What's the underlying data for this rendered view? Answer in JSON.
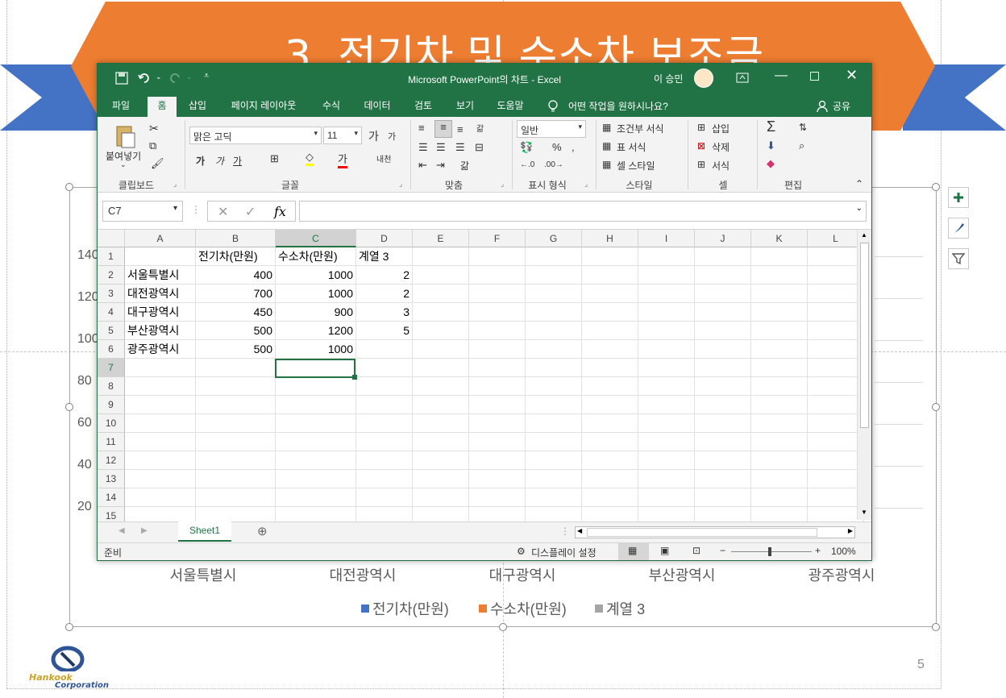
{
  "slide": {
    "title": "3. 전기차 및 수소차 보조금",
    "page_number": "5",
    "logo_text": "Hankook Corporation",
    "y_ticks": [
      "140",
      "120",
      "100",
      "80",
      "60",
      "40",
      "20"
    ],
    "categories": [
      "서울특별시",
      "대전광역시",
      "대구광역시",
      "부산광역시",
      "광주광역시"
    ],
    "legend": [
      {
        "label": "전기차(만원)",
        "color": "#4472c4"
      },
      {
        "label": "수소차(만원)",
        "color": "#ed7d31"
      },
      {
        "label": "계열 3",
        "color": "#a5a5a5"
      }
    ],
    "banner_colors": {
      "orange": "#ed7d31",
      "blue": "#4472c4"
    }
  },
  "excel": {
    "window_title": "Microsoft PowerPoint의 차트  -  Excel",
    "user": "이 승민",
    "tabs": [
      "파일",
      "홈",
      "삽입",
      "페이지 레이아웃",
      "수식",
      "데이터",
      "검토",
      "보기",
      "도움말"
    ],
    "active_tab": "홈",
    "tell_me": "어떤 작업을 원하시나요?",
    "share": "공유",
    "ribbon": {
      "paste": "붙여넣기",
      "clipboard": "클립보드",
      "font_name": "맑은 고딕",
      "font_size": "11",
      "font": "글꼴",
      "alignment": "맞춤",
      "number_format": "일반",
      "number": "표시 형식",
      "cond_format": "조건부 서식",
      "table_format": "표 서식",
      "cell_style": "셀 스타일",
      "styles": "스타일",
      "insert": "삽입",
      "delete": "삭제",
      "format": "서식",
      "cells": "셀",
      "editing": "편집"
    },
    "name_box": "C7",
    "formula": "",
    "columns": [
      "A",
      "B",
      "C",
      "D",
      "E",
      "F",
      "G",
      "H",
      "I",
      "J",
      "K",
      "L"
    ],
    "rows": [
      "1",
      "2",
      "3",
      "4",
      "5",
      "6",
      "7",
      "8",
      "9",
      "10",
      "11",
      "12",
      "13",
      "14",
      "15"
    ],
    "data": [
      [
        "",
        "전기차(만원)",
        "수소차(만원)",
        "계열 3"
      ],
      [
        "서울특별시",
        "400",
        "1000",
        "2"
      ],
      [
        "대전광역시",
        "700",
        "1000",
        "2"
      ],
      [
        "대구광역시",
        "450",
        "900",
        "3"
      ],
      [
        "부산광역시",
        "500",
        "1200",
        "5"
      ],
      [
        "광주광역시",
        "500",
        "1000",
        ""
      ]
    ],
    "sheet_tab": "Sheet1",
    "status": "준비",
    "display_settings": "디스플레이 설정",
    "zoom": "100%"
  }
}
